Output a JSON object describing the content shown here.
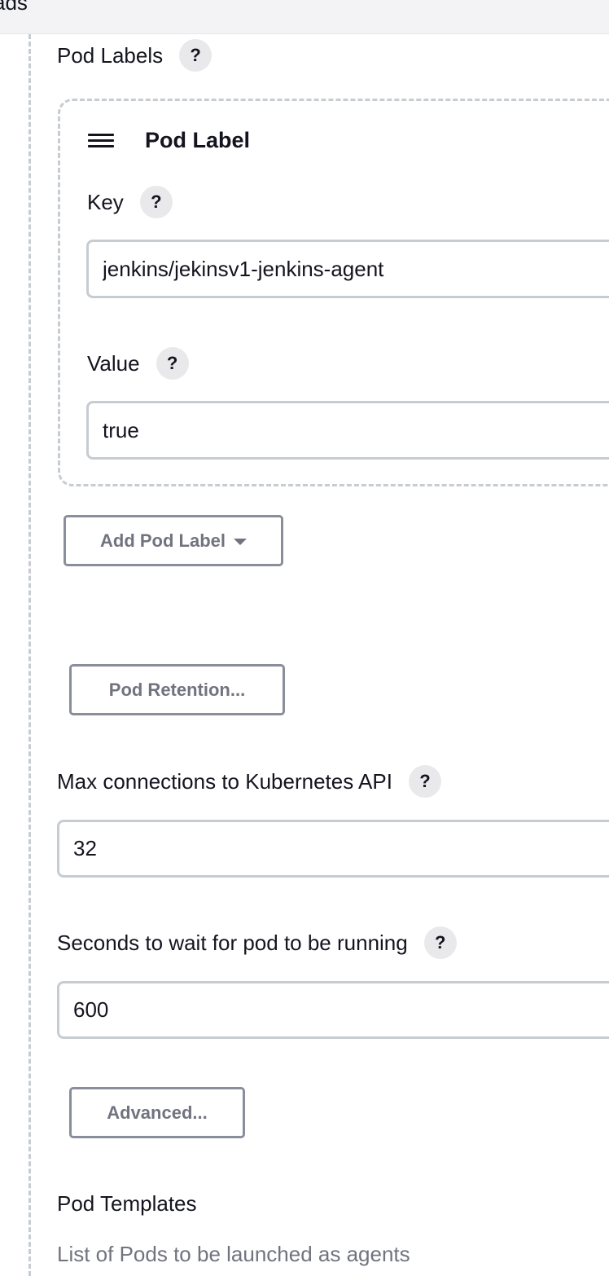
{
  "top_bar": {
    "partial_text": "ads"
  },
  "pod_labels": {
    "label": "Pod Labels",
    "help": "?",
    "item": {
      "title": "Pod Label",
      "key_label": "Key",
      "key_help": "?",
      "key_value": "jenkins/jekinsv1-jenkins-agent",
      "value_label": "Value",
      "value_help": "?",
      "value_value": "true"
    },
    "add_button": "Add Pod Label"
  },
  "pod_retention_button": "Pod Retention...",
  "max_connections": {
    "label": "Max connections to Kubernetes API",
    "help": "?",
    "value": "32"
  },
  "seconds_wait": {
    "label": "Seconds to wait for pod to be running",
    "help": "?",
    "value": "600"
  },
  "advanced_button": "Advanced...",
  "pod_templates": {
    "title": "Pod Templates",
    "description": "List of Pods to be launched as agents"
  },
  "icons": {
    "drag_handle": "hamburger-drag-icon",
    "dropdown": "caret-down-icon",
    "help": "question-mark-icon"
  }
}
